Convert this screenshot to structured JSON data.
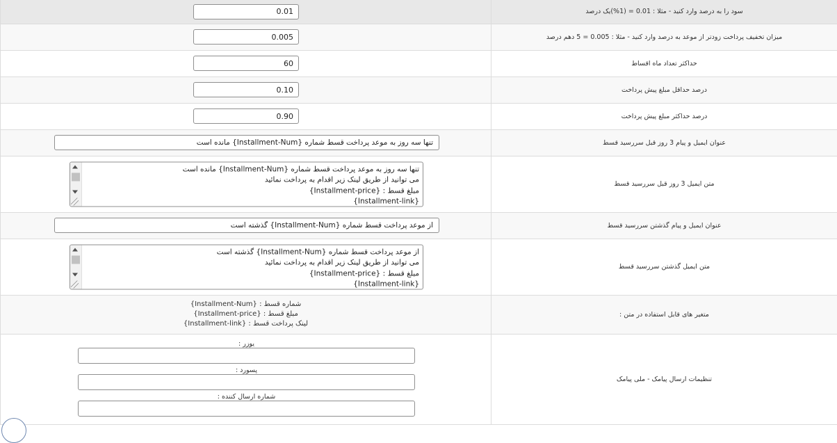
{
  "rows": {
    "profit": {
      "label": "سود را به درصد وارد کنید - مثلا : 0.01 = (1%)یک درصد",
      "value": "0.01"
    },
    "early_discount": {
      "label": "میزان تخفیف پرداخت زودتر از موعد به درصد وارد کنید - مثلا : 0.005 = 5 دهم درصد",
      "value": "0.005"
    },
    "max_months": {
      "label": "حداکثر تعداد ماه اقساط",
      "value": "60"
    },
    "min_prepay": {
      "label": "درصد حداقل مبلغ پیش پرداخت",
      "value": "0.10"
    },
    "max_prepay": {
      "label": "درصد حداکثر مبلغ پیش پرداخت",
      "value": "0.90"
    },
    "reminder_title": {
      "label": "عنوان ایمیل و پیام 3 روز قبل سررسید قسط",
      "value": "تنها سه روز به موعد پرداخت قسط شماره {Installment-Num} مانده است"
    },
    "reminder_body": {
      "label": "متن ایمیل 3 روز قبل سررسید قسط",
      "value": "تنها سه روز به موعد پرداخت قسط شماره {Installment-Num} مانده است\nمی توانید از طریق لینک زیر اقدام به پرداخت نمائید\nمبلغ قسط : {Installment-price}\n{Installment-link}"
    },
    "overdue_title": {
      "label": "عنوان ایمیل و پیام گذشتن سررسید قسط",
      "value": "از موعد پرداخت قسط شماره {Installment-Num} گذشته است"
    },
    "overdue_body": {
      "label": "متن ایمیل گذشتن سررسید قسط",
      "value": "از موعد پرداخت قسط شماره {Installment-Num} گذشته است\nمی توانید از طریق لینک زیر اقدام به پرداخت نمائید\nمبلغ قسط : {Installment-price}\n{Installment-link}"
    },
    "variables": {
      "label": "متغیر های قابل استفاده در متن :",
      "items": [
        "شماره قسط : {Installment-Num}",
        "مبلغ قسط : {Installment-price}",
        "لینک پرداخت قسط : {Installment-link}"
      ]
    },
    "sms": {
      "label": "تنظیمات ارسال پیامک - ملی پیامک",
      "user_label": "یوزر :",
      "user_value": "",
      "password_label": "پسورد :",
      "password_value": "",
      "sender_label": "شماره ارسال کننده :",
      "sender_value": ""
    }
  }
}
